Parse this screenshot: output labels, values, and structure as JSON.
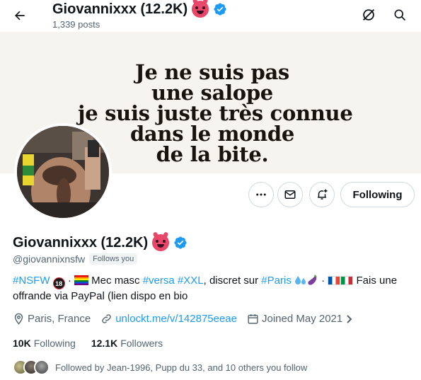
{
  "header": {
    "title": "Giovannixxx (12.2K)",
    "posts": "1,339 posts"
  },
  "banner": {
    "lines": [
      "Je ne suis pas",
      "une salope",
      "je suis juste très connue",
      "dans le monde",
      "de la bite."
    ]
  },
  "actions": {
    "follow_label": "Following"
  },
  "profile": {
    "display_name": "Giovannixxx (12.2K)",
    "handle": "@giovannixnsfw",
    "follows_you": "Follows you",
    "bio": {
      "tag_nsfw": "#NSFW",
      "sep1": " · ",
      "text1": " Mec masc ",
      "tag_versa": "#versa",
      "tag_xxl": "#XXL",
      "text2": ", discret sur ",
      "tag_paris": "#Paris",
      "sep2": " · ",
      "text3": " Fais une offrande via PayPal (lien dispo en bio"
    },
    "location": "Paris, France",
    "link": "unlockt.me/v/142875eeae",
    "joined": "Joined May 2021",
    "following_count": "10K",
    "following_label": "Following",
    "followers_count": "12.1K",
    "followers_label": "Followers",
    "followed_by": "Followed by Jean-1996, Pupp du 33, and 10 others you follow"
  },
  "colors": {
    "accent": "#1d9bf0",
    "secondary_text": "#536471",
    "banner_bg": "#f6f4ee"
  }
}
